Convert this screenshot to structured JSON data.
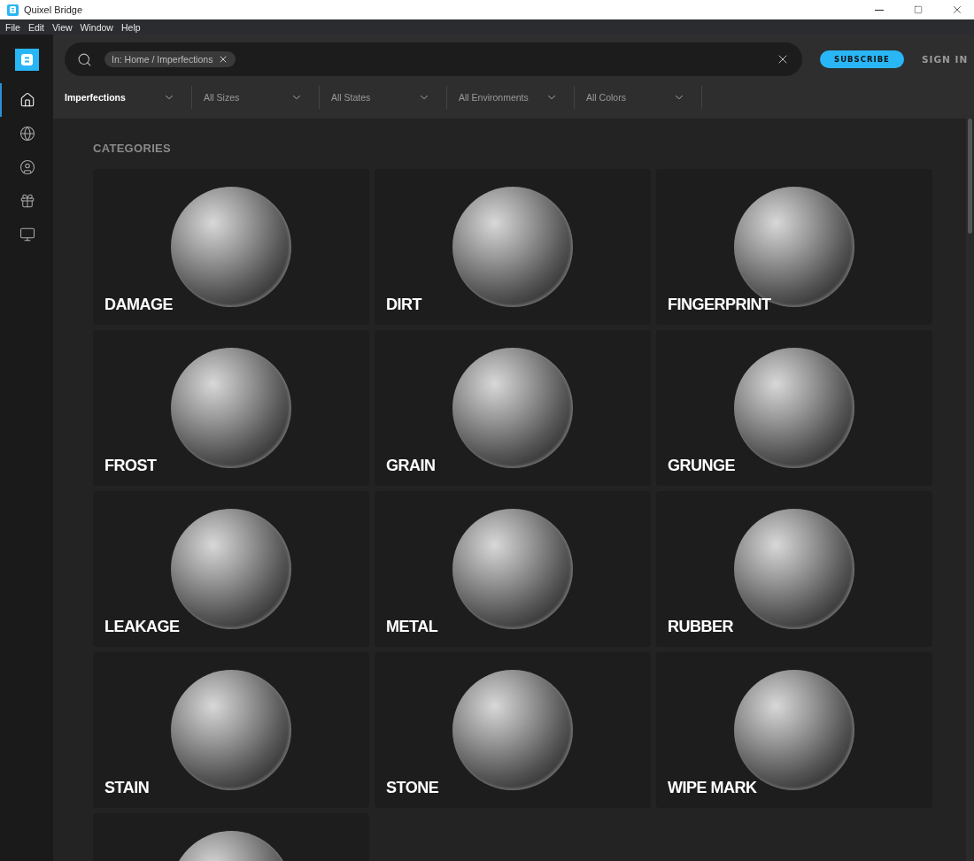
{
  "window": {
    "title": "Quixel Bridge"
  },
  "menu": [
    "File",
    "Edit",
    "View",
    "Window",
    "Help"
  ],
  "sidebar": {
    "items": [
      {
        "selected": true
      },
      {
        "selected": false
      },
      {
        "selected": false
      },
      {
        "selected": false
      },
      {
        "selected": false
      }
    ]
  },
  "search": {
    "chip": "In: Home / Imperfections"
  },
  "subscribe": "SUBSCRIBE",
  "sign_in": "SIGN IN",
  "filters": [
    {
      "label": "Imperfections",
      "active": true
    },
    {
      "label": "All Sizes",
      "active": false
    },
    {
      "label": "All States",
      "active": false
    },
    {
      "label": "All Environments",
      "active": false
    },
    {
      "label": "All Colors",
      "active": false
    }
  ],
  "section_title": "CATEGORIES",
  "categories": [
    {
      "kind": "full",
      "name": "DAMAGE"
    },
    {
      "kind": "full",
      "name": "DIRT"
    },
    {
      "kind": "full",
      "name": "FINGERPRINT"
    },
    {
      "kind": "full",
      "name": "FROST"
    },
    {
      "kind": "full",
      "name": "GRAIN"
    },
    {
      "kind": "full",
      "name": "GRUNGE"
    },
    {
      "kind": "full",
      "name": "LEAKAGE"
    },
    {
      "kind": "full",
      "name": "METAL"
    },
    {
      "kind": "full",
      "name": "RUBBER"
    },
    {
      "kind": "full",
      "name": "STAIN"
    },
    {
      "kind": "full",
      "name": "STONE"
    },
    {
      "kind": "full",
      "name": "WIPE MARK"
    },
    {
      "kind": "cut"
    }
  ]
}
